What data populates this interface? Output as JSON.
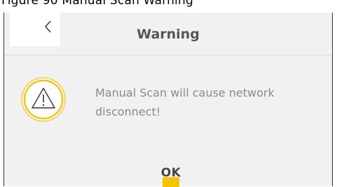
{
  "header_cut_text": "Figure 90 Manual Scan Warning",
  "dialog": {
    "title": "Warning",
    "message": "Manual Scan will cause network disconnect!",
    "ok_label": "OK",
    "back_icon": "chevron-left-icon",
    "warning_icon": "warning-triangle-icon"
  },
  "colors": {
    "accent": "#f5c400",
    "dialog_bg": "#f1f1f1",
    "title_text": "#555555",
    "message_text": "#8a8a8a"
  }
}
